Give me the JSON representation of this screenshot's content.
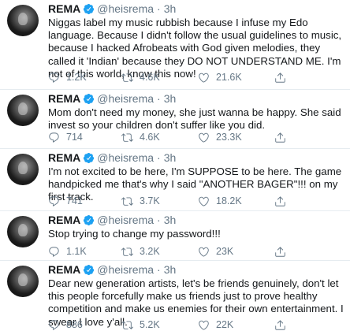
{
  "tweets": [
    {
      "name": "REMA",
      "handle": "@heisrema",
      "time": "3h",
      "text": "Niggas label my music rubbish because I infuse my Edo language. Because I didn't follow the usual guidelines to music, because I hacked Afrobeats with God given melodies, they called it 'Indian' because they DO NOT UNDERSTAND ME. I'm not of this world, know this now!",
      "replies": "1.2K",
      "retweets": "4.6K",
      "likes": "21.6K"
    },
    {
      "name": "REMA",
      "handle": "@heisrema",
      "time": "3h",
      "text": "Mom don't need my money, she just wanna be happy. She said invest so your children don't suffer like you did.",
      "replies": "714",
      "retweets": "4.6K",
      "likes": "23.3K"
    },
    {
      "name": "REMA",
      "handle": "@heisrema",
      "time": "3h",
      "text": "I'm not excited to be here, I'm SUPPOSE to be here. The game handpicked me that's why I said \"ANOTHER BAGER\"!!! on my first track.",
      "replies": "741",
      "retweets": "3.7K",
      "likes": "18.2K"
    },
    {
      "name": "REMA",
      "handle": "@heisrema",
      "time": "3h",
      "text": "Stop trying to change my password!!!",
      "replies": "1.1K",
      "retweets": "3.2K",
      "likes": "23K"
    },
    {
      "name": "REMA",
      "handle": "@heisrema",
      "time": "3h",
      "text": "Dear new generation artists, let's be friends genuinely, don't let this people forcefully make us friends just to prove healthy competition and make us enemies for their own entertainment. I swear I love y'all.",
      "replies": "886",
      "retweets": "5.2K",
      "likes": "22K"
    }
  ],
  "colors": {
    "name": "#14171a",
    "muted": "#657786",
    "verified": "#1da1f2",
    "divider": "#e6ecf0"
  },
  "icons": [
    "verified-badge-icon",
    "reply-icon",
    "retweet-icon",
    "like-icon",
    "share-icon"
  ]
}
